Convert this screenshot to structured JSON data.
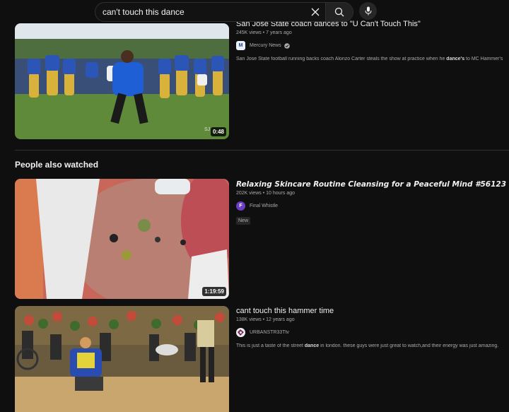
{
  "search": {
    "query": "can't touch this dance"
  },
  "icons": {
    "clear": "close-icon",
    "search": "search-icon",
    "mic": "microphone-icon"
  },
  "videos": [
    {
      "title": "San Jose State coach dances to \"U Can't Touch This\"",
      "meta": "245K views • 7 years ago",
      "channel": "Mercury News",
      "avatar": "M",
      "verified": true,
      "description_pre": "San Jose State football running backs coach Alonzo Carter steals the show at practice when he ",
      "description_hl": "dance's",
      "description_post": " to MC Hammer's",
      "duration": "0:48"
    }
  ],
  "section": {
    "title": "People also watched"
  },
  "related": [
    {
      "title": "Relaxing Skincare Routine Cleansing for a Peaceful Mind #56123",
      "meta": "202K views • 10 hours ago",
      "channel": "Final Whistle",
      "avatar": "F",
      "badge": "New",
      "duration": "1:19:59"
    },
    {
      "title": "cant touch this hammer time",
      "meta": "138K views • 12 years ago",
      "channel": "URBANSTR33Ttv",
      "description_pre": "This is just a taste of the street ",
      "description_hl": "dance",
      "description_post": " in london. these guys were just great to watch,and their energy was just amazing."
    }
  ],
  "colors": {
    "background": "#0f0f0f",
    "text": "#f1f1f1",
    "meta": "#aaaaaa",
    "final_whistle_avatar": "#6b3fc4"
  }
}
